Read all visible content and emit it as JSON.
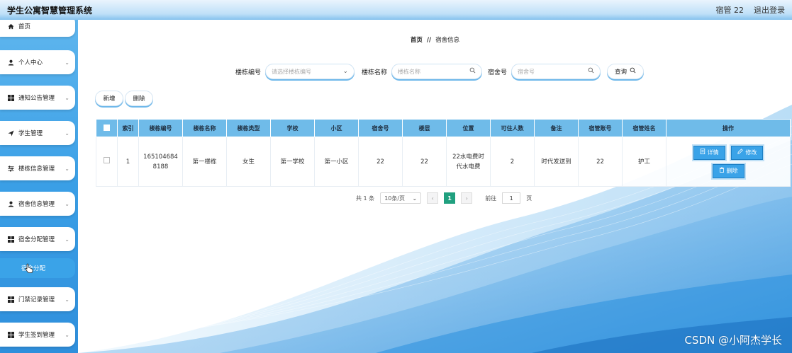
{
  "header": {
    "title": "学生公寓智慧管理系统",
    "user": "宿管 22",
    "logout": "退出登录"
  },
  "sidebar": {
    "items": [
      {
        "label": "首页",
        "icon": "home-icon"
      },
      {
        "label": "个人中心",
        "icon": "user-icon"
      },
      {
        "label": "通知公告管理",
        "icon": "grid-icon"
      },
      {
        "label": "学生管理",
        "icon": "send-icon"
      },
      {
        "label": "楼栋信息管理",
        "icon": "sliders-icon"
      },
      {
        "label": "宿舍信息管理",
        "icon": "user-icon"
      },
      {
        "label": "宿舍分配管理",
        "icon": "grid-icon"
      },
      {
        "label": "门禁记录管理",
        "icon": "grid-icon"
      },
      {
        "label": "学生签到管理",
        "icon": "grid-icon"
      }
    ],
    "sub_active": "宿舍分配"
  },
  "breadcrumb": {
    "home": "首页",
    "sep": "//",
    "current": "宿舍信息"
  },
  "search": {
    "building_no_label": "楼栋编号",
    "building_no_placeholder": "请选择楼栋编号",
    "building_name_label": "楼栋名称",
    "building_name_placeholder": "楼栋名称",
    "room_label": "宿舍号",
    "room_placeholder": "宿舍号",
    "query_button": "查询"
  },
  "actions": {
    "add": "新增",
    "delete": "删除"
  },
  "table": {
    "headers": [
      "索引",
      "楼栋编号",
      "楼栋名称",
      "楼栋类型",
      "学校",
      "小区",
      "宿舍号",
      "楼层",
      "位置",
      "可住人数",
      "备注",
      "宿管账号",
      "宿管姓名",
      "操作"
    ],
    "rows": [
      {
        "index": "1",
        "building_no": "1651046848188",
        "building_name": "第一楼栋",
        "building_type": "女生",
        "school": "第一学校",
        "community": "第一小区",
        "room_no": "22",
        "floor": "22",
        "location": "22水电费时代水电费",
        "capacity": "2",
        "remark": "时代发送到",
        "manager_account": "22",
        "manager_name": "护工",
        "ops": {
          "detail": "详情",
          "edit": "修改",
          "delete": "删除"
        }
      }
    ]
  },
  "pagination": {
    "total": "共 1 条",
    "page_size": "10条/页",
    "current": "1",
    "goto_label": "前往",
    "goto_value": "1",
    "page_unit": "页"
  },
  "watermark": "CSDN @小阿杰学长",
  "colors": {
    "accent": "#3aa3e8",
    "header_blue": "#6fbbe9",
    "pager_green": "#20a07f"
  }
}
